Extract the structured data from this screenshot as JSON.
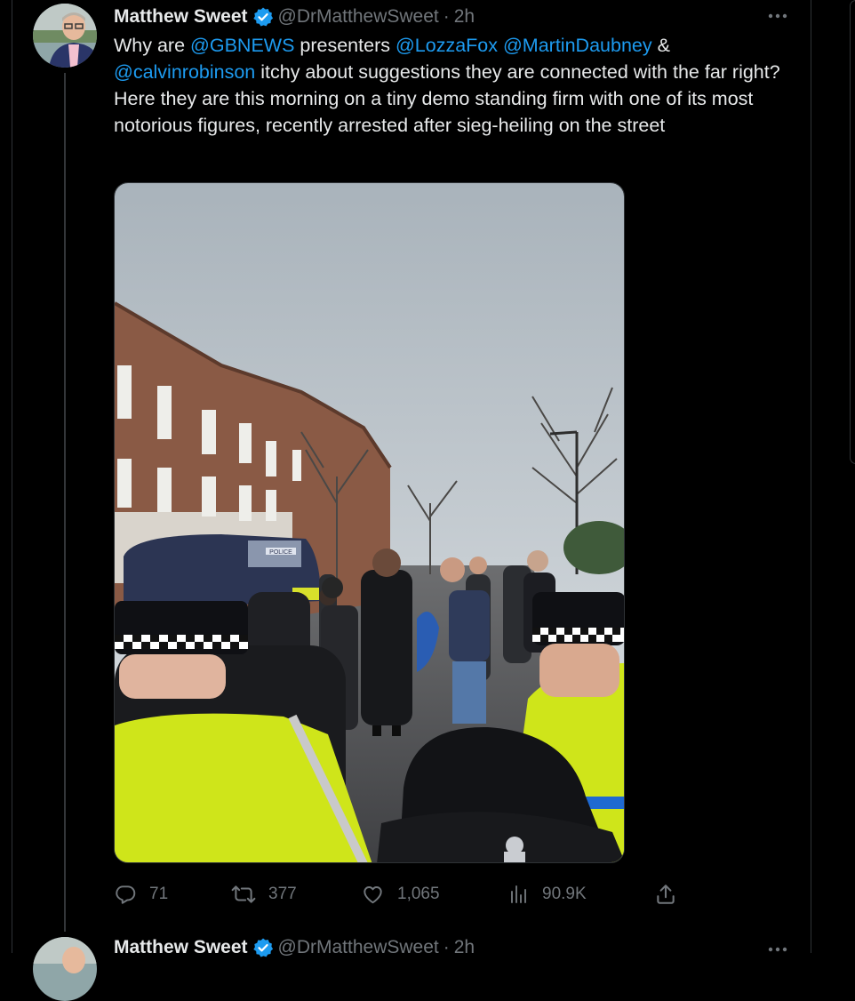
{
  "tweet": {
    "author_name": "Matthew Sweet",
    "handle": "@DrMatthewSweet",
    "separator": "·",
    "time": "2h",
    "text": {
      "p1": "Why are ",
      "m1": "@GBNEWS",
      "p2": " presenters ",
      "m2": "@LozzaFox",
      "p3": " ",
      "m3": "@MartinDaubney",
      "p4": " & ",
      "m4": "@calvinrobinson",
      "p5": " itchy about suggestions they are connected with the far right? Here they are this morning on a tiny demo standing firm with one of its most notorious figures, recently arrested after sieg-heiling on the street"
    },
    "media_sign": "POLICE",
    "actions": {
      "replies": "71",
      "retweets": "377",
      "likes": "1,065",
      "views": "90.9K"
    }
  },
  "next_tweet": {
    "author_name": "Matthew Sweet",
    "handle": "@DrMatthewSweet",
    "separator": "·",
    "time": "2h"
  },
  "icons": [
    "verified-badge-icon",
    "more-icon",
    "reply-icon",
    "retweet-icon",
    "like-icon",
    "views-icon",
    "share-icon"
  ],
  "colors": {
    "background": "#000000",
    "text": "#e7e9ea",
    "muted": "#71767b",
    "link": "#1d9bf0",
    "border": "#2f3336"
  }
}
